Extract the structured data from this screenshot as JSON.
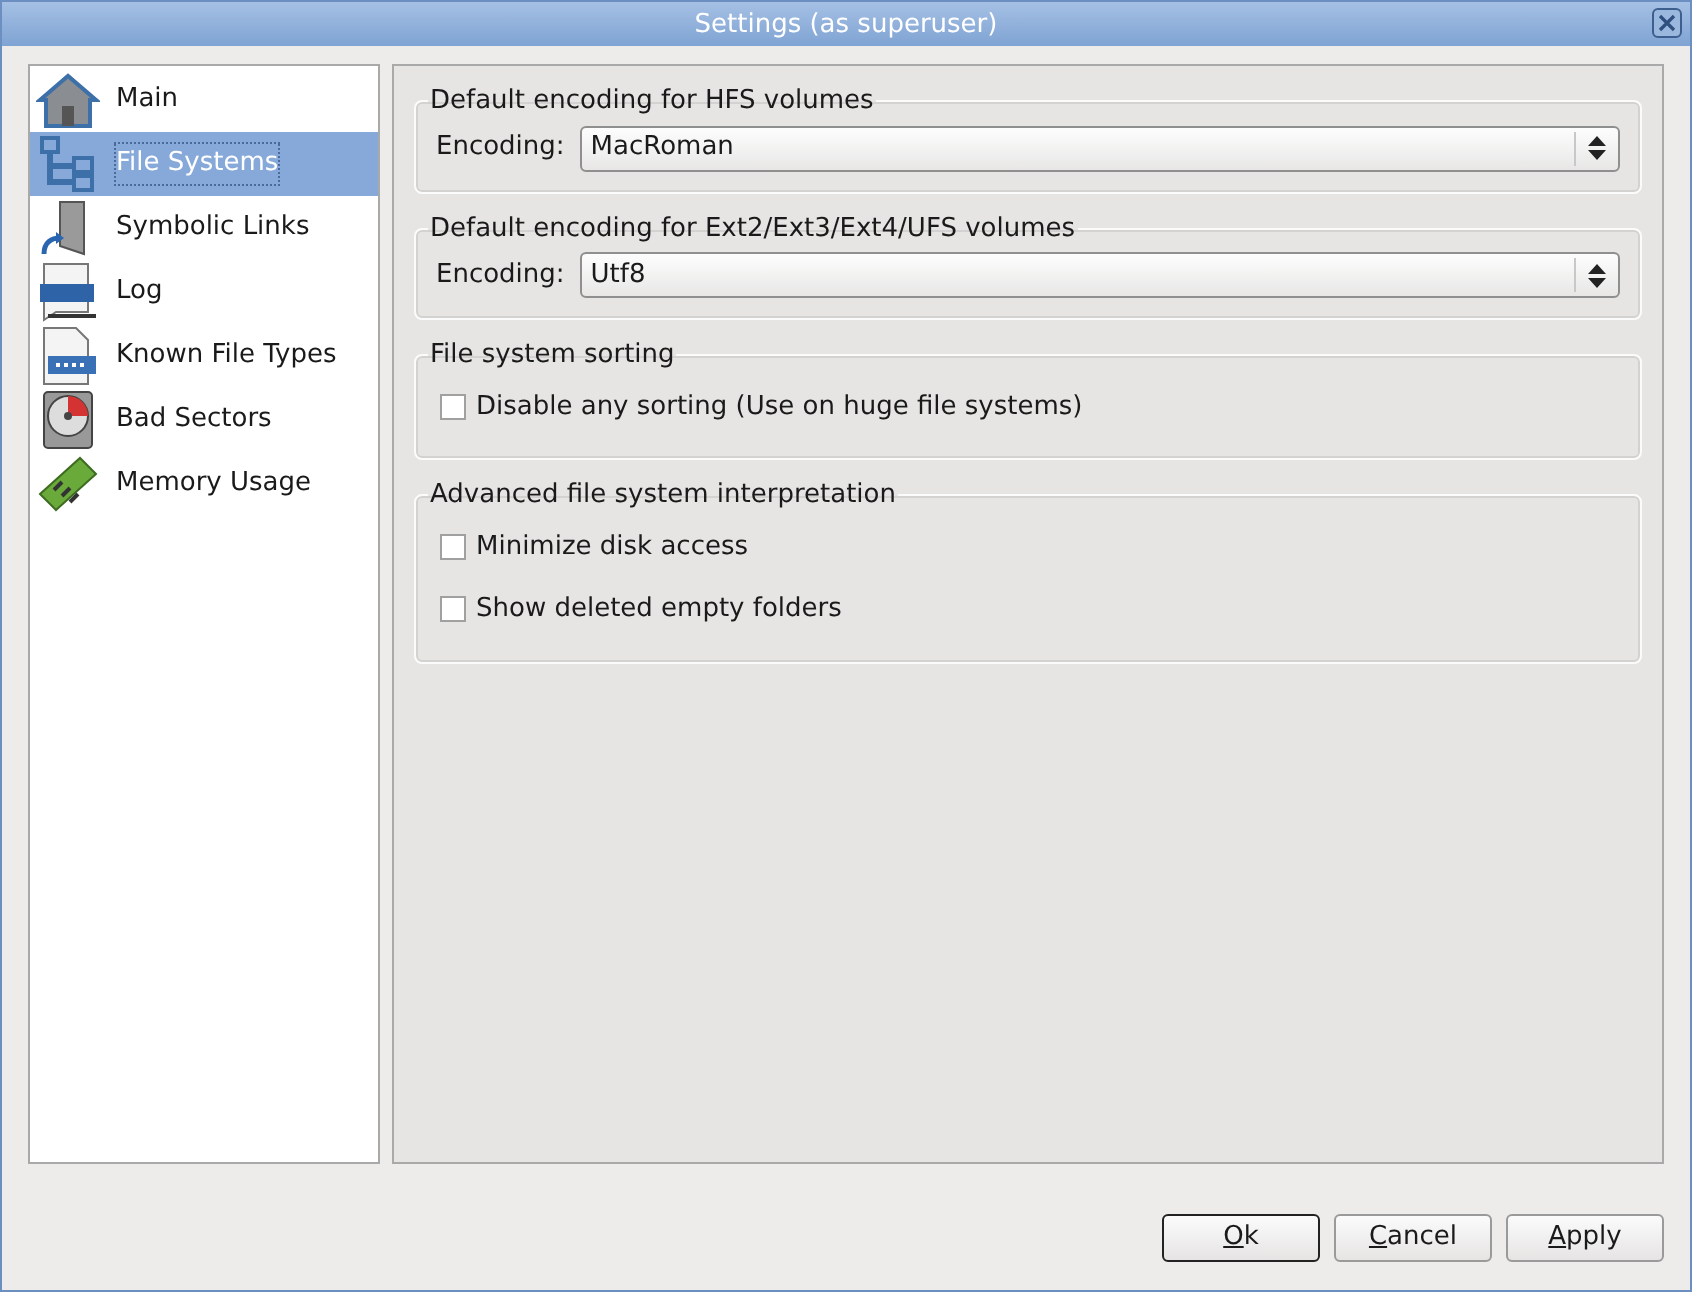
{
  "window": {
    "title": "Settings (as superuser)"
  },
  "sidebar": {
    "items": [
      {
        "label": "Main",
        "kind": "house",
        "selected": false
      },
      {
        "label": "File Systems",
        "kind": "tree",
        "selected": true
      },
      {
        "label": "Symbolic Links",
        "kind": "link",
        "selected": false
      },
      {
        "label": "Log",
        "kind": "log",
        "selected": false
      },
      {
        "label": "Known File Types",
        "kind": "filetype",
        "selected": false
      },
      {
        "label": "Bad Sectors",
        "kind": "disk",
        "selected": false
      },
      {
        "label": "Memory Usage",
        "kind": "memory",
        "selected": false
      }
    ]
  },
  "groups": [
    {
      "title": "Default encoding for HFS volumes",
      "kind": "select",
      "label": "Encoding:",
      "value": "MacRoman"
    },
    {
      "title": "Default encoding for Ext2/Ext3/Ext4/UFS volumes",
      "kind": "select",
      "label": "Encoding:",
      "value": "Utf8"
    },
    {
      "title": "File system sorting",
      "kind": "checks",
      "options": [
        {
          "label": "Disable any sorting (Use on huge file systems)",
          "checked": false
        }
      ]
    },
    {
      "title": "Advanced file system interpretation",
      "kind": "checks",
      "options": [
        {
          "label": "Minimize disk access",
          "checked": false
        },
        {
          "label": "Show deleted empty folders",
          "checked": false
        }
      ]
    }
  ],
  "buttons": [
    {
      "label": "Ok",
      "default": true
    },
    {
      "label": "Cancel",
      "default": false
    },
    {
      "label": "Apply",
      "default": false
    }
  ]
}
